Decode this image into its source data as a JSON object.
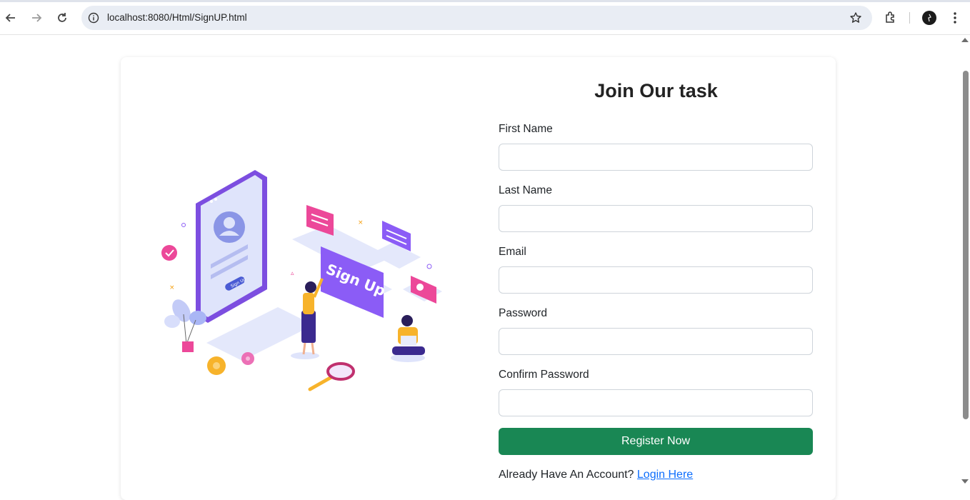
{
  "browser": {
    "url": "localhost:8080/Html/SignUP.html"
  },
  "form": {
    "title": "Join Our task",
    "fields": [
      {
        "label": "First Name",
        "value": ""
      },
      {
        "label": "Last Name",
        "value": ""
      },
      {
        "label": "Email",
        "value": ""
      },
      {
        "label": "Password",
        "value": ""
      },
      {
        "label": "Confirm Password",
        "value": ""
      }
    ],
    "submit_label": "Register Now",
    "login_prompt": "Already Have An Account?",
    "login_link": "Login Here"
  },
  "illustration": {
    "sign_text": "Sign Up",
    "phone_button_text": "Sign Up"
  },
  "colors": {
    "primary_button": "#198754",
    "link": "#0d6efd",
    "illustration_purple": "#8b5cf6",
    "illustration_pink": "#ec4899"
  },
  "icons": [
    "back-icon",
    "forward-icon",
    "reload-icon",
    "info-icon",
    "star-icon",
    "extensions-icon",
    "profile-avatar",
    "menu-icon"
  ]
}
